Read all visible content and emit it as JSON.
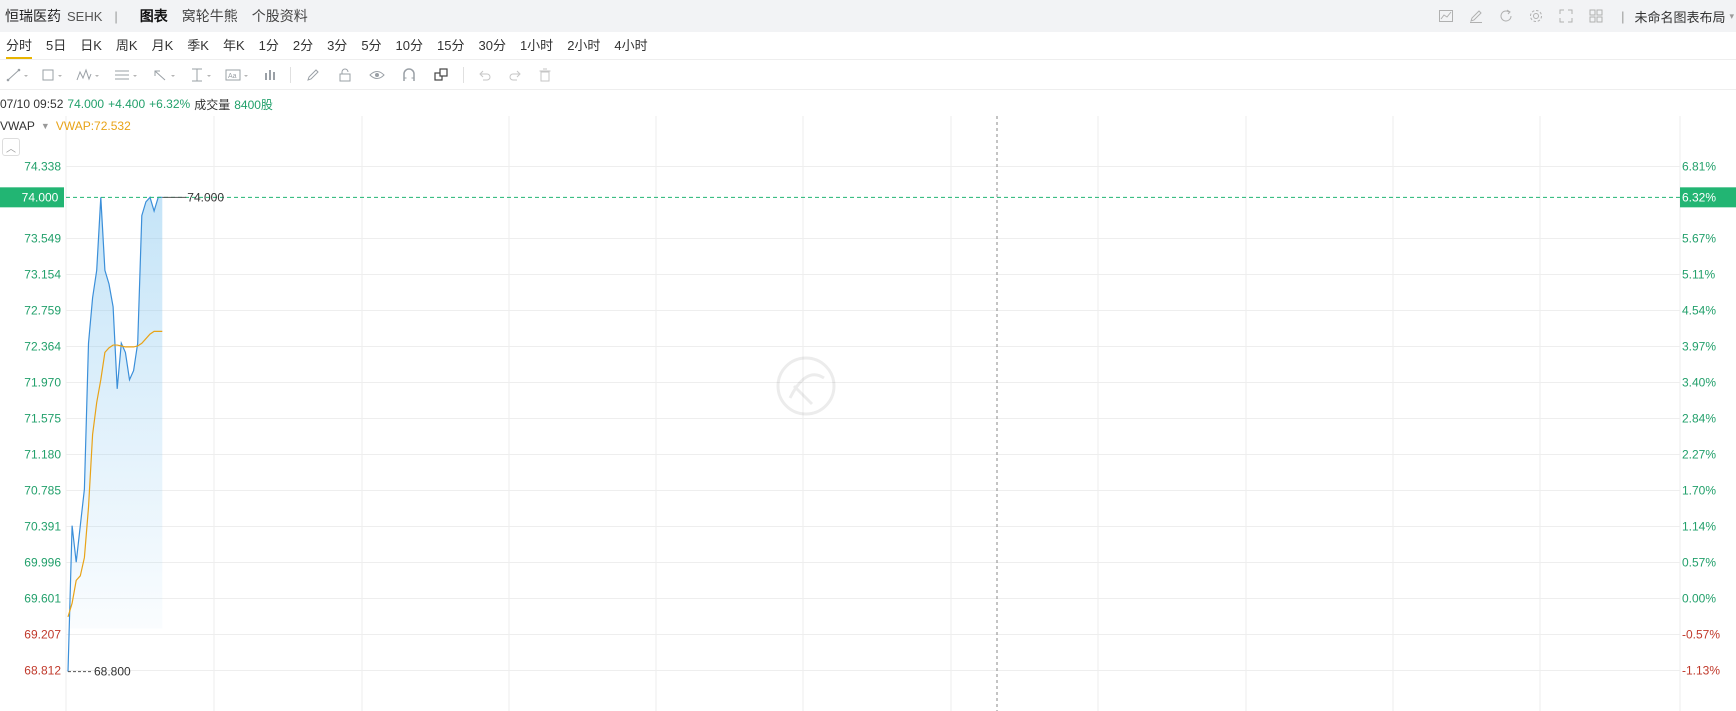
{
  "header": {
    "stock_name": "恒瑞医药",
    "market": "SEHK",
    "separator": "|",
    "tabs": [
      {
        "label": "图表",
        "active": true
      },
      {
        "label": "窝轮牛熊",
        "active": false
      },
      {
        "label": "个股资料",
        "active": false
      }
    ],
    "layout_name": "未命名图表布局",
    "tool_icons": [
      "indicator-icon",
      "draw-icon",
      "refresh-icon",
      "settings-icon",
      "fullscreen-icon",
      "layout-grid-icon"
    ]
  },
  "periods": [
    "分时",
    "5日",
    "日K",
    "周K",
    "月K",
    "季K",
    "年K",
    "1分",
    "2分",
    "3分",
    "5分",
    "10分",
    "15分",
    "30分",
    "1小时",
    "2小时",
    "4小时"
  ],
  "active_period": "分时",
  "info": {
    "time": "07/10 09:52",
    "price": "74.000",
    "change": "+4.400",
    "change_pct": "+6.32%",
    "volume_label": "成交量",
    "volume": "8400股"
  },
  "indicator": {
    "name": "VWAP",
    "value_label": "VWAP:72.532"
  },
  "colors": {
    "up": "#22a06b",
    "down": "#c0392b",
    "price_line": "#3b8fd9",
    "vwap_line": "#e8a317",
    "grid": "#eeeeee",
    "badge": "#22b573"
  },
  "chart_data": {
    "type": "line",
    "y_ticks_left": [
      "74.338",
      "73.549",
      "73.154",
      "72.759",
      "72.364",
      "71.970",
      "71.575",
      "71.180",
      "70.785",
      "70.391",
      "69.996",
      "69.601",
      "69.207",
      "68.812"
    ],
    "y_ticks_right": [
      "6.81%",
      "5.67%",
      "5.11%",
      "4.54%",
      "3.97%",
      "3.40%",
      "2.84%",
      "2.27%",
      "1.70%",
      "1.14%",
      "0.57%",
      "0.00%",
      "-0.57%",
      "-1.13%"
    ],
    "ylim": [
      68.812,
      74.338
    ],
    "prev_close": 69.601,
    "current_price_label": "74.000",
    "current_pct_label": "6.32%",
    "high_label": "74.000",
    "low_label": "68.800",
    "series": [
      {
        "name": "",
        "values": [
          68.8,
          70.4,
          70.0,
          70.4,
          70.8,
          72.4,
          72.9,
          73.2,
          74.0,
          73.2,
          73.05,
          72.8,
          71.9,
          72.4,
          72.3,
          72.0,
          72.1,
          72.4,
          73.8,
          73.95,
          74.0,
          73.85,
          74.0,
          74.0
        ],
        "high_value": 74.0,
        "low_value": 68.8
      },
      {
        "name": "VWAP",
        "values": [
          69.4,
          69.55,
          69.8,
          69.85,
          70.05,
          70.6,
          71.4,
          71.75,
          72.0,
          72.3,
          72.35,
          72.38,
          72.38,
          72.37,
          72.36,
          72.36,
          72.36,
          72.37,
          72.4,
          72.45,
          72.5,
          72.53,
          72.53,
          72.53
        ]
      }
    ],
    "grid": true
  }
}
